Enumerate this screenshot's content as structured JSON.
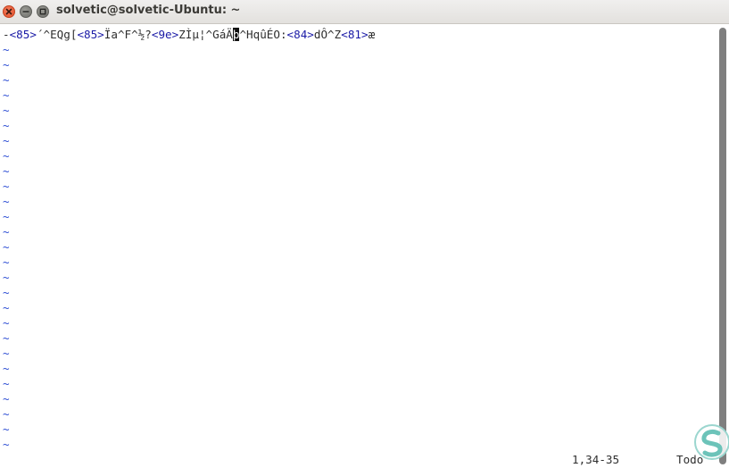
{
  "window": {
    "title": "solvetic@solvetic-Ubuntu: ~",
    "buttons": [
      "close",
      "minimize",
      "maximize"
    ]
  },
  "editor": {
    "first_line_segments": [
      {
        "type": "text",
        "text": "-"
      },
      {
        "type": "escape",
        "text": "<85>"
      },
      {
        "type": "text",
        "text": "´^EQg["
      },
      {
        "type": "escape",
        "text": "<85>"
      },
      {
        "type": "text",
        "text": "Ïa^F^½?"
      },
      {
        "type": "escape",
        "text": "<9e>"
      },
      {
        "type": "text",
        "text": "ZÌµ¦^GáÄ"
      },
      {
        "type": "cursor",
        "text": "þ"
      },
      {
        "type": "text",
        "text": "^HqûÉO:"
      },
      {
        "type": "escape",
        "text": "<84>"
      },
      {
        "type": "text",
        "text": "dÔ^Z"
      },
      {
        "type": "escape",
        "text": "<81>"
      },
      {
        "type": "text",
        "text": "æ"
      }
    ],
    "empty_line_marker": "~",
    "empty_line_count": 27,
    "cursor_position": "1,34-35",
    "scroll_position": "Todo"
  },
  "colors": {
    "text": "#2e2e2e",
    "escape": "#1a1aa6",
    "tilde": "#2f4fd4",
    "close_button": "#e2512c",
    "scrollbar": "#7f7f7f"
  },
  "icons": [
    "close-icon",
    "minimize-icon",
    "maximize-icon",
    "watermark-logo"
  ]
}
